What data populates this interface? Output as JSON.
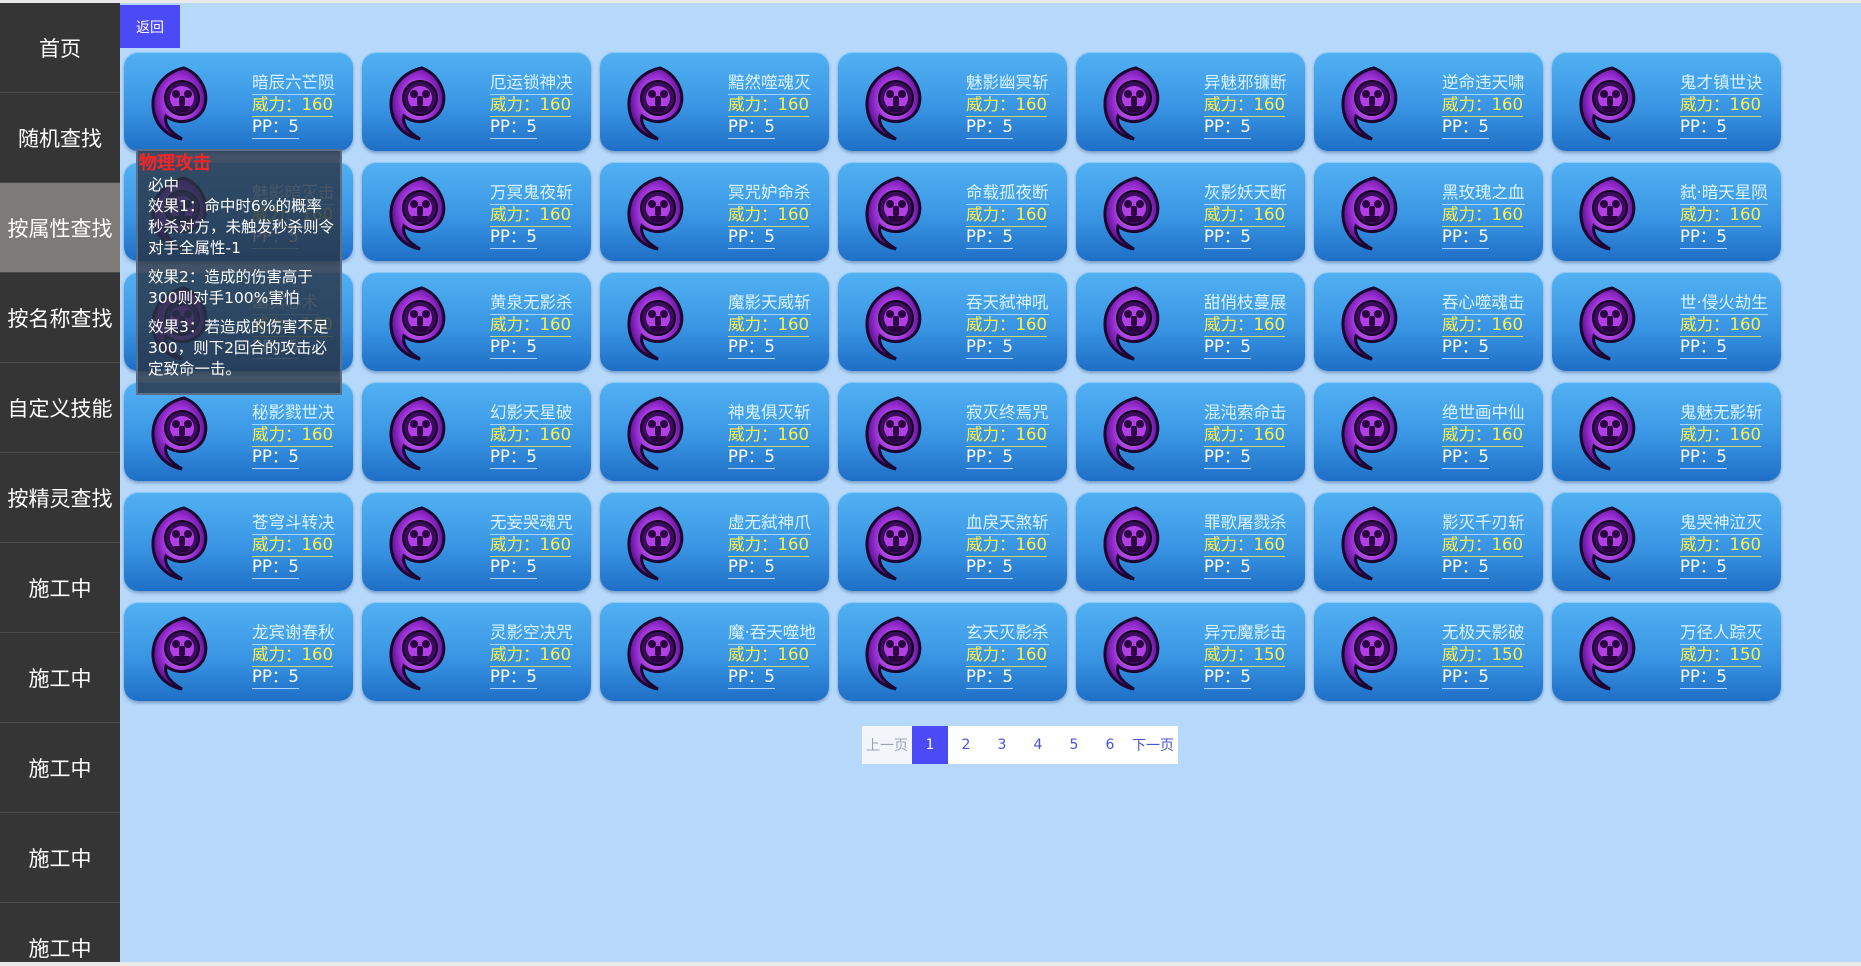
{
  "sidebar": {
    "items": [
      {
        "label": "首页"
      },
      {
        "label": "随机查找"
      },
      {
        "label": "按属性查找",
        "active": true
      },
      {
        "label": "按名称查找"
      },
      {
        "label": "自定义技能"
      },
      {
        "label": "按精灵查找"
      },
      {
        "label": "施工中"
      },
      {
        "label": "施工中"
      },
      {
        "label": "施工中"
      },
      {
        "label": "施工中"
      },
      {
        "label": "施工中"
      }
    ]
  },
  "back_label": "返回",
  "skills": [
    {
      "name": "暗辰六芒陨",
      "power": "威力：160",
      "pp": "PP：5"
    },
    {
      "name": "厄运锁神决",
      "power": "威力：160",
      "pp": "PP：5"
    },
    {
      "name": "黯然噬魂灭",
      "power": "威力：160",
      "pp": "PP：5"
    },
    {
      "name": "魅影幽冥斩",
      "power": "威力：160",
      "pp": "PP：5"
    },
    {
      "name": "异魅邪镰断",
      "power": "威力：160",
      "pp": "PP：5"
    },
    {
      "name": "逆命违天啸",
      "power": "威力：160",
      "pp": "PP：5"
    },
    {
      "name": "鬼才镇世诀",
      "power": "威力：160",
      "pp": "PP：5"
    },
    {
      "name": "魅影暗灭击",
      "power": "威力：160",
      "pp": "PP：5"
    },
    {
      "name": "万冥鬼夜斩",
      "power": "威力：160",
      "pp": "PP：5"
    },
    {
      "name": "冥咒妒命杀",
      "power": "威力：160",
      "pp": "PP：5"
    },
    {
      "name": "命载孤夜断",
      "power": "威力：160",
      "pp": "PP：5"
    },
    {
      "name": "灰影妖天断",
      "power": "威力：160",
      "pp": "PP：5"
    },
    {
      "name": "黑玫瑰之血",
      "power": "威力：160",
      "pp": "PP：5"
    },
    {
      "name": "弑·暗天星陨",
      "power": "威力：160",
      "pp": "PP：5"
    },
    {
      "name": "幽冥心术",
      "power": "威力：160",
      "pp": "PP：5"
    },
    {
      "name": "黄泉无影杀",
      "power": "威力：160",
      "pp": "PP：5"
    },
    {
      "name": "魔影天威斩",
      "power": "威力：160",
      "pp": "PP：5"
    },
    {
      "name": "吞天弑神吼",
      "power": "威力：160",
      "pp": "PP：5"
    },
    {
      "name": "甜俏枝蔓展",
      "power": "威力：160",
      "pp": "PP：5"
    },
    {
      "name": "吞心噬魂击",
      "power": "威力：160",
      "pp": "PP：5"
    },
    {
      "name": "世·侵火劫生",
      "power": "威力：160",
      "pp": "PP：5"
    },
    {
      "name": "秘影戮世决",
      "power": "威力：160",
      "pp": "PP：5"
    },
    {
      "name": "幻影天星破",
      "power": "威力：160",
      "pp": "PP：5"
    },
    {
      "name": "神鬼俱灭斩",
      "power": "威力：160",
      "pp": "PP：5"
    },
    {
      "name": "寂灭终焉咒",
      "power": "威力：160",
      "pp": "PP：5"
    },
    {
      "name": "混沌索命击",
      "power": "威力：160",
      "pp": "PP：5"
    },
    {
      "name": "绝世画中仙",
      "power": "威力：160",
      "pp": "PP：5"
    },
    {
      "name": "鬼魅无影斩",
      "power": "威力：160",
      "pp": "PP：5"
    },
    {
      "name": "苍穹斗转决",
      "power": "威力：160",
      "pp": "PP：5"
    },
    {
      "name": "无妄哭魂咒",
      "power": "威力：160",
      "pp": "PP：5"
    },
    {
      "name": "虚无弑神爪",
      "power": "威力：160",
      "pp": "PP：5"
    },
    {
      "name": "血戾天煞斩",
      "power": "威力：160",
      "pp": "PP：5"
    },
    {
      "name": "罪歌屠戮杀",
      "power": "威力：160",
      "pp": "PP：5"
    },
    {
      "name": "影灭千刃斩",
      "power": "威力：160",
      "pp": "PP：5"
    },
    {
      "name": "鬼哭神泣灭",
      "power": "威力：160",
      "pp": "PP：5"
    },
    {
      "name": "龙宾谢春秋",
      "power": "威力：160",
      "pp": "PP：5"
    },
    {
      "name": "灵影空决咒",
      "power": "威力：160",
      "pp": "PP：5"
    },
    {
      "name": "魔·吞天噬地",
      "power": "威力：160",
      "pp": "PP：5"
    },
    {
      "name": "玄天灭影杀",
      "power": "威力：160",
      "pp": "PP：5"
    },
    {
      "name": "异元魔影击",
      "power": "威力：150",
      "pp": "PP：5"
    },
    {
      "name": "无极天影破",
      "power": "威力：150",
      "pp": "PP：5"
    },
    {
      "name": "万径人踪灭",
      "power": "威力：150",
      "pp": "PP：5"
    }
  ],
  "tooltip": {
    "title": "物理攻击",
    "line_sure": "必中",
    "effect1": "效果1：命中时6%的概率秒杀对方，未触发秒杀则令对手全属性-1",
    "effect2": "效果2：造成的伤害高于300则对手100%害怕",
    "effect3": "效果3：若造成的伤害不足300，则下2回合的攻击必定致命一击。"
  },
  "pagination": {
    "prev": "上一页",
    "pages": [
      "1",
      "2",
      "3",
      "4",
      "5",
      "6"
    ],
    "current": "1",
    "next": "下一页"
  },
  "colors": {
    "sidebar_bg": "#353535",
    "sidebar_active": "#7e7a78",
    "page_bg": "#b6d9fb",
    "accent": "#4a4af7",
    "skill_name": "#d8f4ff",
    "power": "#fff04a",
    "tooltip_title": "#ff2222"
  },
  "icon": "ghost-swirl-emblem-icon"
}
